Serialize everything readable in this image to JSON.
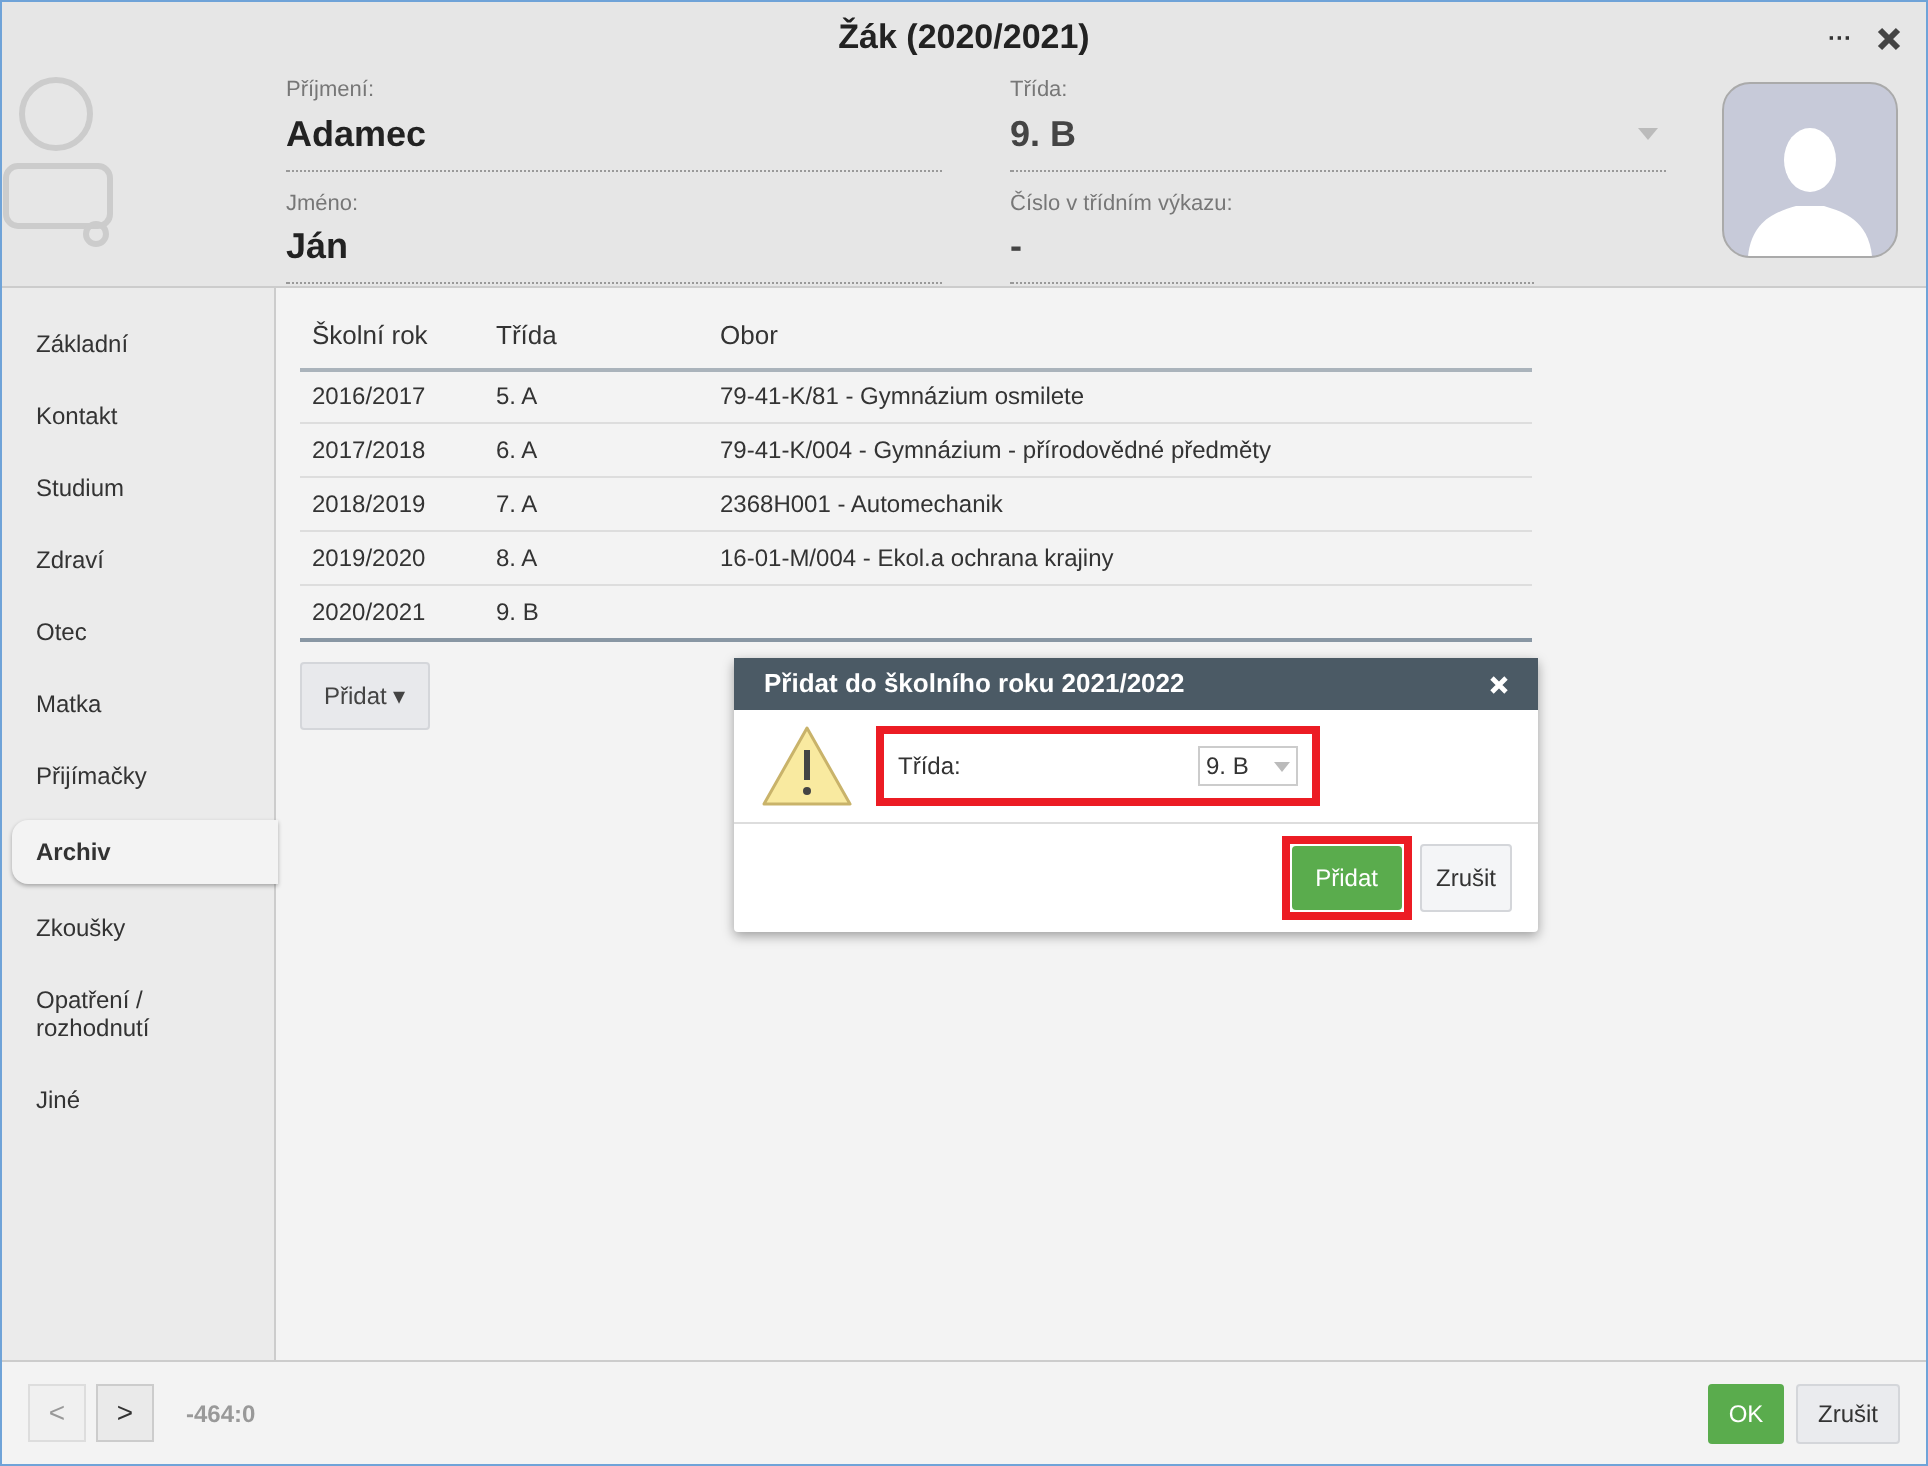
{
  "window": {
    "title": "Žák (2020/2021)",
    "menu_icon": "···"
  },
  "student": {
    "surname_label": "Příjmení:",
    "surname": "Adamec",
    "name_label": "Jméno:",
    "name": "Ján",
    "class_label": "Třída:",
    "class": "9. B",
    "register_label": "Číslo v třídním výkazu:",
    "register": "-"
  },
  "sidebar": {
    "items": [
      {
        "label": "Základní",
        "selected": false
      },
      {
        "label": "Kontakt",
        "selected": false
      },
      {
        "label": "Studium",
        "selected": false
      },
      {
        "label": "Zdraví",
        "selected": false
      },
      {
        "label": "Otec",
        "selected": false
      },
      {
        "label": "Matka",
        "selected": false
      },
      {
        "label": "Přijímačky",
        "selected": false
      },
      {
        "label": "Archiv",
        "selected": true
      },
      {
        "label": "Zkoušky",
        "selected": false
      },
      {
        "label": "Opatření / rozhodnutí",
        "selected": false
      },
      {
        "label": "Jiné",
        "selected": false
      }
    ]
  },
  "table": {
    "columns": [
      "Školní rok",
      "Třída",
      "Obor"
    ],
    "rows": [
      [
        "2016/2017",
        "5. A",
        "79-41-K/81 - Gymnázium osmilete"
      ],
      [
        "2017/2018",
        "6. A",
        "79-41-K/004 - Gymnázium - přírodovědné předměty"
      ],
      [
        "2018/2019",
        "7. A",
        "2368H001 - Automechanik"
      ],
      [
        "2019/2020",
        "8. A",
        "16-01-M/004 - Ekol.a ochrana krajiny"
      ],
      [
        "2020/2021",
        "9. B",
        ""
      ]
    ]
  },
  "add_button": {
    "label": "Přidat",
    "caret": "▾"
  },
  "dialog": {
    "title": "Přidat do školního roku 2021/2022",
    "class_label": "Třída:",
    "class_value": "9. B",
    "confirm": "Přidat",
    "cancel": "Zrušit"
  },
  "footer": {
    "prev": {
      "label": "<",
      "disabled": true
    },
    "next": {
      "label": ">",
      "disabled": false
    },
    "position": "-464:0",
    "ok": "OK",
    "cancel": "Zrušit"
  }
}
